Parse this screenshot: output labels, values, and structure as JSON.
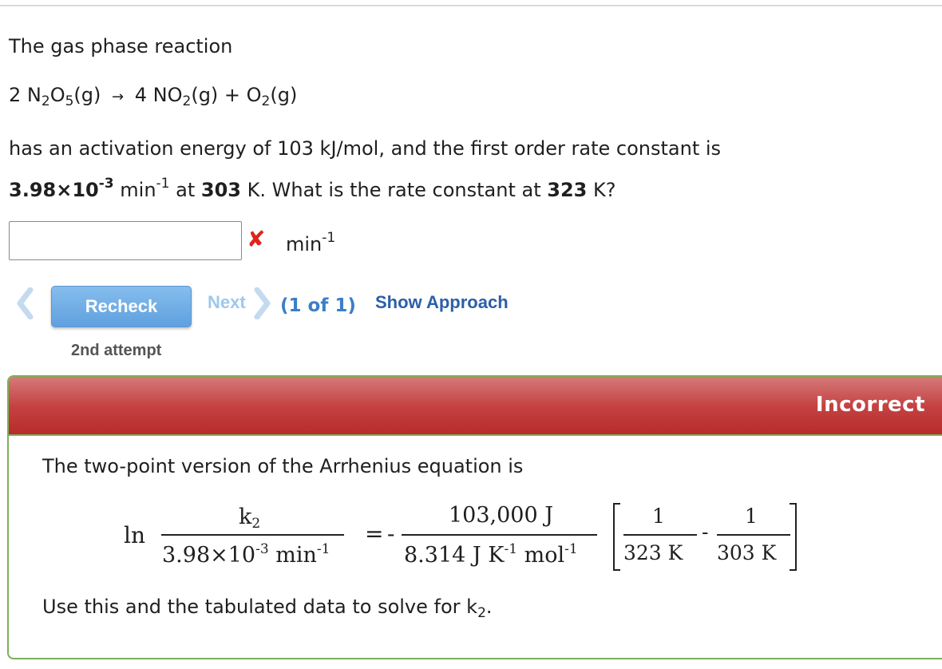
{
  "question": {
    "intro": "The gas phase reaction",
    "reaction": {
      "coef1": "2 N",
      "sub1": "2",
      "mid1": "O",
      "sub2": "5",
      "tail1": "(g)",
      "arrow": "→",
      "coef2": "4 NO",
      "sub3": "2",
      "tail2": "(g) + O",
      "sub4": "2",
      "tail3": "(g)"
    },
    "line1": "has an activation energy of 103 kJ/mol, and the first order rate constant is",
    "k1_mantissa": "3.98×10",
    "k1_exp": "-3",
    "unit_min": "min",
    "unit_exp": "-1",
    "at_text": "at",
    "T1": "303",
    "q_text": "K. What is the rate constant at",
    "T2": "323",
    "end_text": "K?"
  },
  "answer": {
    "value": "",
    "placeholder": "",
    "mark": "✘",
    "unit": "min",
    "unit_exp": "-1"
  },
  "nav": {
    "recheck_label": "Recheck",
    "next_label": "Next",
    "counter": "(1 of 1)",
    "approach_label": "Show Approach",
    "attempt": "2nd attempt"
  },
  "feedback": {
    "status": "Incorrect",
    "intro": "The two-point version of the Arrhenius equation is",
    "eq": {
      "ln": "ln",
      "num_left": "k",
      "num_left_sub": "2",
      "den_left": "3.98×10",
      "den_left_exp": "-3",
      "den_left_unit": "min",
      "den_left_unit_exp": "-1",
      "equals": "=",
      "minus": "-",
      "num_mid": "103,000 J",
      "den_mid": "8.314 J K",
      "den_mid_exp1": "-1",
      "den_mid_mol": "mol",
      "den_mid_exp2": "-1",
      "one_a": "1",
      "den_a": "323 K",
      "minus2": "-",
      "one_b": "1",
      "den_b": "303 K"
    },
    "outro": "Use this and the tabulated data to solve for k",
    "outro_sub": "2",
    "outro_end": "."
  },
  "colors": {
    "incorrect": "#c54343",
    "link": "#2b5fa8",
    "button": "#6aa8e2",
    "x_mark": "#e0241b",
    "border_green": "#7bb05a"
  }
}
